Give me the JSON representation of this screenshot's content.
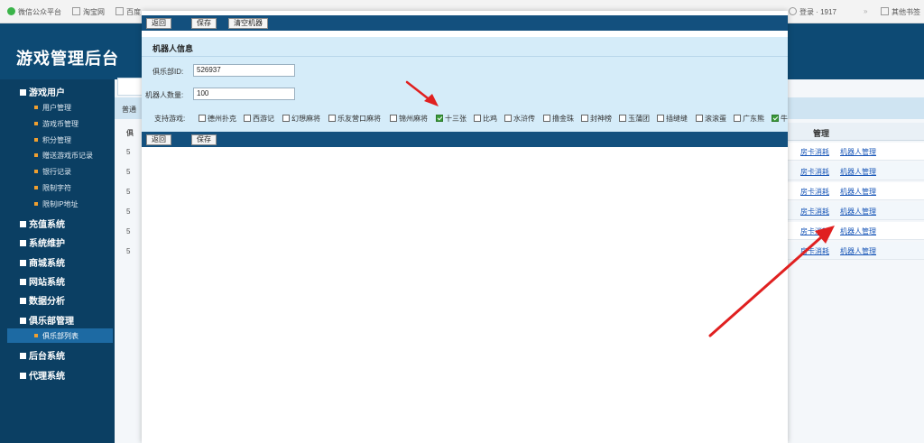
{
  "browser": {
    "bookmarks": [
      {
        "label": "微信公众平台",
        "icon": "wechat-icon"
      },
      {
        "label": "淘宝网",
        "icon": "taobao-icon"
      },
      {
        "label": "百度",
        "icon": "baidu-icon"
      }
    ],
    "right": {
      "login": "登录 · 1917",
      "other_bookmarks": "其他书签"
    }
  },
  "admin": {
    "title": "游戏管理后台",
    "sidebar": {
      "groups": [
        {
          "label": "游戏用户",
          "expanded": true,
          "items": [
            "用户管理",
            "游戏币管理",
            "积分管理",
            "赠送游戏币记录",
            "银行记录",
            "限制字符",
            "限制IP地址"
          ]
        },
        {
          "label": "充值系统"
        },
        {
          "label": "系统维护"
        },
        {
          "label": "商城系统"
        },
        {
          "label": "网站系统"
        },
        {
          "label": "数据分析"
        },
        {
          "label": "俱乐部管理",
          "expanded": true,
          "items": [
            "俱乐部列表"
          ],
          "active_item": "俱乐部列表"
        },
        {
          "label": "后台系统"
        },
        {
          "label": "代理系统"
        }
      ]
    },
    "background_table": {
      "column_header": "管理",
      "rows": [
        {
          "a": "房卡消耗",
          "b": "机器人管理"
        },
        {
          "a": "房卡消耗",
          "b": "机器人管理"
        },
        {
          "a": "房卡消耗",
          "b": "机器人管理"
        },
        {
          "a": "房卡消耗",
          "b": "机器人管理"
        },
        {
          "a": "房卡消耗",
          "b": "机器人管理"
        },
        {
          "a": "房卡消耗",
          "b": "机器人管理"
        }
      ],
      "left_fragments": [
        "俱",
        "5",
        "5",
        "5",
        "5",
        "5",
        "5"
      ],
      "strip_text": "普通"
    }
  },
  "modal": {
    "toolbar_top": {
      "back": "返回",
      "save": "保存",
      "clear": "清空机器"
    },
    "heading": "机器人信息",
    "club_id_label": "俱乐部ID:",
    "club_id_value": "526937",
    "robot_count_label": "机器人数量:",
    "robot_count_value": "100",
    "games_label": "支持游戏:",
    "games": [
      {
        "label": "德州扑克",
        "checked": false
      },
      {
        "label": "西游记",
        "checked": false
      },
      {
        "label": "幻想麻将",
        "checked": false
      },
      {
        "label": "乐友营口麻将",
        "checked": false
      },
      {
        "label": "锦州麻将",
        "checked": false
      },
      {
        "label": "十三张",
        "checked": true
      },
      {
        "label": "比鸡",
        "checked": false
      },
      {
        "label": "水浒传",
        "checked": false
      },
      {
        "label": "撸金珠",
        "checked": false
      },
      {
        "label": "封神榜",
        "checked": false
      },
      {
        "label": "玉蒲团",
        "checked": false
      },
      {
        "label": "插缝缝",
        "checked": false
      },
      {
        "label": "滚滚蛋",
        "checked": false
      },
      {
        "label": "广东熊",
        "checked": false
      },
      {
        "label": "牛",
        "checked": true
      }
    ],
    "toolbar_bottom": {
      "back": "返回",
      "save": "保存"
    }
  },
  "colors": {
    "header": "#0d4a74",
    "sidebar": "#0b3f63",
    "modal_bar": "#13507e",
    "form_bg": "#d5ecf9",
    "arrow": "#e02020"
  }
}
